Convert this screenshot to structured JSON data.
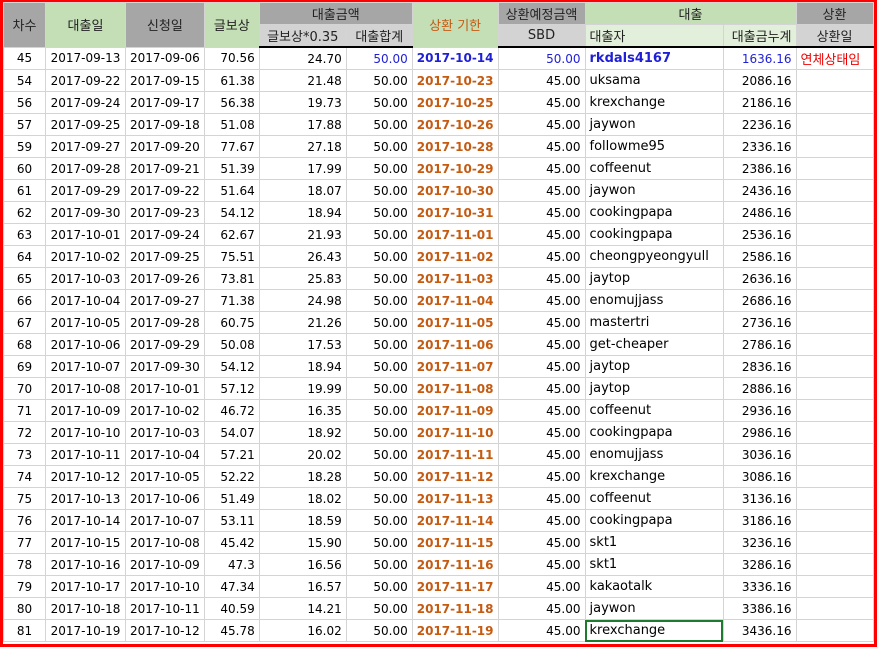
{
  "headers": {
    "round": "차수",
    "loan_date": "대출일",
    "apply_date": "신청일",
    "post_reward": "글보상",
    "loan_amount": "대출금액",
    "reward_035": "글보상*0.35",
    "loan_total": "대출합계",
    "due": "상환 기한",
    "planned": "상환예정금액",
    "sbd": "SBD",
    "loan": "대출",
    "borrower": "대출자",
    "cumulative": "대출금누계",
    "repay": "상환",
    "repay_date": "상환일"
  },
  "rows": [
    [
      "45",
      "2017-09-13",
      "2017-09-06",
      "70.56",
      "24.70",
      "50.00",
      "2017-10-14",
      "50.00",
      "rkdals4167",
      "1636.16",
      "연체상태임"
    ],
    [
      "54",
      "2017-09-22",
      "2017-09-15",
      "61.38",
      "21.48",
      "50.00",
      "2017-10-23",
      "45.00",
      "uksama",
      "2086.16",
      ""
    ],
    [
      "56",
      "2017-09-24",
      "2017-09-17",
      "56.38",
      "19.73",
      "50.00",
      "2017-10-25",
      "45.00",
      "krexchange",
      "2186.16",
      ""
    ],
    [
      "57",
      "2017-09-25",
      "2017-09-18",
      "51.08",
      "17.88",
      "50.00",
      "2017-10-26",
      "45.00",
      "jaywon",
      "2236.16",
      ""
    ],
    [
      "59",
      "2017-09-27",
      "2017-09-20",
      "77.67",
      "27.18",
      "50.00",
      "2017-10-28",
      "45.00",
      "followme95",
      "2336.16",
      ""
    ],
    [
      "60",
      "2017-09-28",
      "2017-09-21",
      "51.39",
      "17.99",
      "50.00",
      "2017-10-29",
      "45.00",
      "coffeenut",
      "2386.16",
      ""
    ],
    [
      "61",
      "2017-09-29",
      "2017-09-22",
      "51.64",
      "18.07",
      "50.00",
      "2017-10-30",
      "45.00",
      "jaywon",
      "2436.16",
      ""
    ],
    [
      "62",
      "2017-09-30",
      "2017-09-23",
      "54.12",
      "18.94",
      "50.00",
      "2017-10-31",
      "45.00",
      "cookingpapa",
      "2486.16",
      ""
    ],
    [
      "63",
      "2017-10-01",
      "2017-09-24",
      "62.67",
      "21.93",
      "50.00",
      "2017-11-01",
      "45.00",
      "cookingpapa",
      "2536.16",
      ""
    ],
    [
      "64",
      "2017-10-02",
      "2017-09-25",
      "75.51",
      "26.43",
      "50.00",
      "2017-11-02",
      "45.00",
      "cheongpyeongyull",
      "2586.16",
      ""
    ],
    [
      "65",
      "2017-10-03",
      "2017-09-26",
      "73.81",
      "25.83",
      "50.00",
      "2017-11-03",
      "45.00",
      "jaytop",
      "2636.16",
      ""
    ],
    [
      "66",
      "2017-10-04",
      "2017-09-27",
      "71.38",
      "24.98",
      "50.00",
      "2017-11-04",
      "45.00",
      "enomujjass",
      "2686.16",
      ""
    ],
    [
      "67",
      "2017-10-05",
      "2017-09-28",
      "60.75",
      "21.26",
      "50.00",
      "2017-11-05",
      "45.00",
      "mastertri",
      "2736.16",
      ""
    ],
    [
      "68",
      "2017-10-06",
      "2017-09-29",
      "50.08",
      "17.53",
      "50.00",
      "2017-11-06",
      "45.00",
      "get-cheaper",
      "2786.16",
      ""
    ],
    [
      "69",
      "2017-10-07",
      "2017-09-30",
      "54.12",
      "18.94",
      "50.00",
      "2017-11-07",
      "45.00",
      "jaytop",
      "2836.16",
      ""
    ],
    [
      "70",
      "2017-10-08",
      "2017-10-01",
      "57.12",
      "19.99",
      "50.00",
      "2017-11-08",
      "45.00",
      "jaytop",
      "2886.16",
      ""
    ],
    [
      "71",
      "2017-10-09",
      "2017-10-02",
      "46.72",
      "16.35",
      "50.00",
      "2017-11-09",
      "45.00",
      "coffeenut",
      "2936.16",
      ""
    ],
    [
      "72",
      "2017-10-10",
      "2017-10-03",
      "54.07",
      "18.92",
      "50.00",
      "2017-11-10",
      "45.00",
      "cookingpapa",
      "2986.16",
      ""
    ],
    [
      "73",
      "2017-10-11",
      "2017-10-04",
      "57.21",
      "20.02",
      "50.00",
      "2017-11-11",
      "45.00",
      "enomujjass",
      "3036.16",
      ""
    ],
    [
      "74",
      "2017-10-12",
      "2017-10-05",
      "52.22",
      "18.28",
      "50.00",
      "2017-11-12",
      "45.00",
      "krexchange",
      "3086.16",
      ""
    ],
    [
      "75",
      "2017-10-13",
      "2017-10-06",
      "51.49",
      "18.02",
      "50.00",
      "2017-11-13",
      "45.00",
      "coffeenut",
      "3136.16",
      ""
    ],
    [
      "76",
      "2017-10-14",
      "2017-10-07",
      "53.11",
      "18.59",
      "50.00",
      "2017-11-14",
      "45.00",
      "cookingpapa",
      "3186.16",
      ""
    ],
    [
      "77",
      "2017-10-15",
      "2017-10-08",
      "45.42",
      "15.90",
      "50.00",
      "2017-11-15",
      "45.00",
      "skt1",
      "3236.16",
      ""
    ],
    [
      "78",
      "2017-10-16",
      "2017-10-09",
      "47.3",
      "16.56",
      "50.00",
      "2017-11-16",
      "45.00",
      "skt1",
      "3286.16",
      ""
    ],
    [
      "79",
      "2017-10-17",
      "2017-10-10",
      "47.34",
      "16.57",
      "50.00",
      "2017-11-17",
      "45.00",
      "kakaotalk",
      "3336.16",
      ""
    ],
    [
      "80",
      "2017-10-18",
      "2017-10-11",
      "40.59",
      "14.21",
      "50.00",
      "2017-11-18",
      "45.00",
      "jaywon",
      "3386.16",
      ""
    ],
    [
      "81",
      "2017-10-19",
      "2017-10-12",
      "45.78",
      "16.02",
      "50.00",
      "2017-11-19",
      "45.00",
      "krexchange",
      "3436.16",
      ""
    ]
  ]
}
